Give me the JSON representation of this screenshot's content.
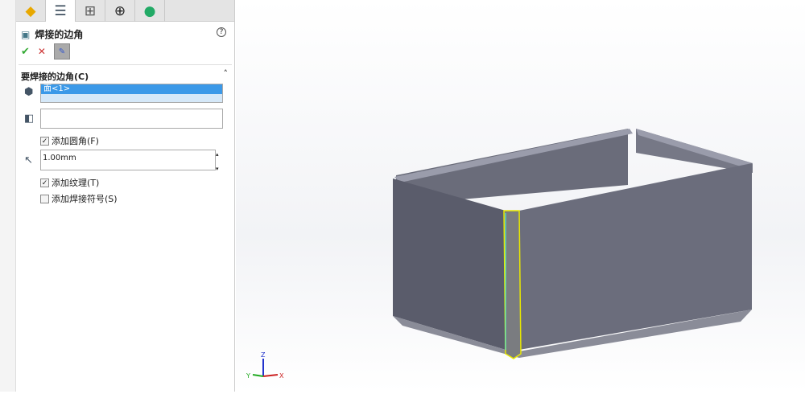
{
  "panel": {
    "tabs": [
      "feature-manager",
      "property-manager",
      "configuration-manager",
      "dimxpert-manager",
      "display-manager"
    ],
    "title": "焊接的边角",
    "help": "?",
    "ok": "✔",
    "cancel": "✕",
    "pin": "📌",
    "section": "要焊接的边角(C)",
    "face_selection": "面<1>",
    "second_selection": "",
    "add_fillet": {
      "label": "添加圆角(F)",
      "checked": true
    },
    "radius": "1.00mm",
    "add_texture": {
      "label": "添加纹理(T)",
      "checked": true
    },
    "add_weld_symbol": {
      "label": "添加焊接符号(S)",
      "checked": false
    }
  },
  "triad": {
    "x": "X",
    "y": "Y",
    "z": "Z"
  },
  "colors": {
    "model": "#5f6170",
    "highlight": "#e8e800",
    "selection": "#3b99e8"
  }
}
